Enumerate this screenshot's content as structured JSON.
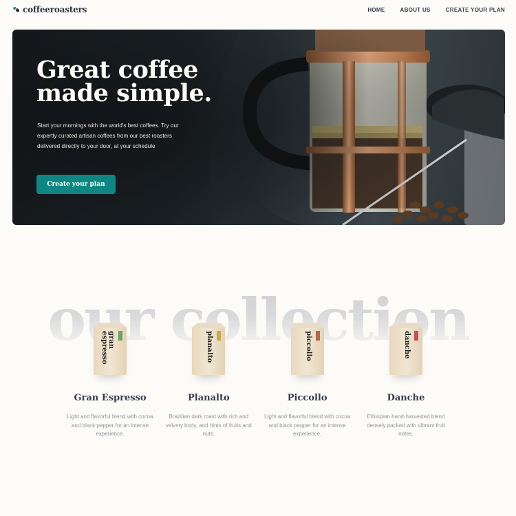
{
  "header": {
    "logo_text": "coffeeroasters",
    "nav": [
      "HOME",
      "ABOUT US",
      "CREATE YOUR PLAN"
    ]
  },
  "hero": {
    "title_line1": "Great coffee",
    "title_line2": "made simple.",
    "text": "Start your mornings with the world's best coffees. Try our expertly curated artisan coffees from our best roasters delivered directly to your door, at your schedule",
    "button": "Create your plan"
  },
  "collection": {
    "heading": "our collection",
    "products": [
      {
        "name": "Gran Espresso",
        "bag_label": "gran espresso",
        "desc": "Light and flavorful blend with cocoa and black pepper for an intense experience.",
        "tag_color": "#6ca06a"
      },
      {
        "name": "Planalto",
        "bag_label": "planalto",
        "desc": "Brazilian dark roast with rich and velvety body, and hints of fruits and nuts.",
        "tag_color": "#c8a94a"
      },
      {
        "name": "Piccollo",
        "bag_label": "piccollo",
        "desc": "Light and flavorful blend with cocoa and black pepper for an intense experience.",
        "tag_color": "#b06848"
      },
      {
        "name": "Danche",
        "bag_label": "danche",
        "desc": "Ethiopian hand-harvested blend densely packed with vibrant fruit notes.",
        "tag_color": "#c44f59"
      }
    ]
  },
  "colors": {
    "accent": "#0e8784",
    "background": "#fdfbf8",
    "text_dark": "#333d4b"
  }
}
